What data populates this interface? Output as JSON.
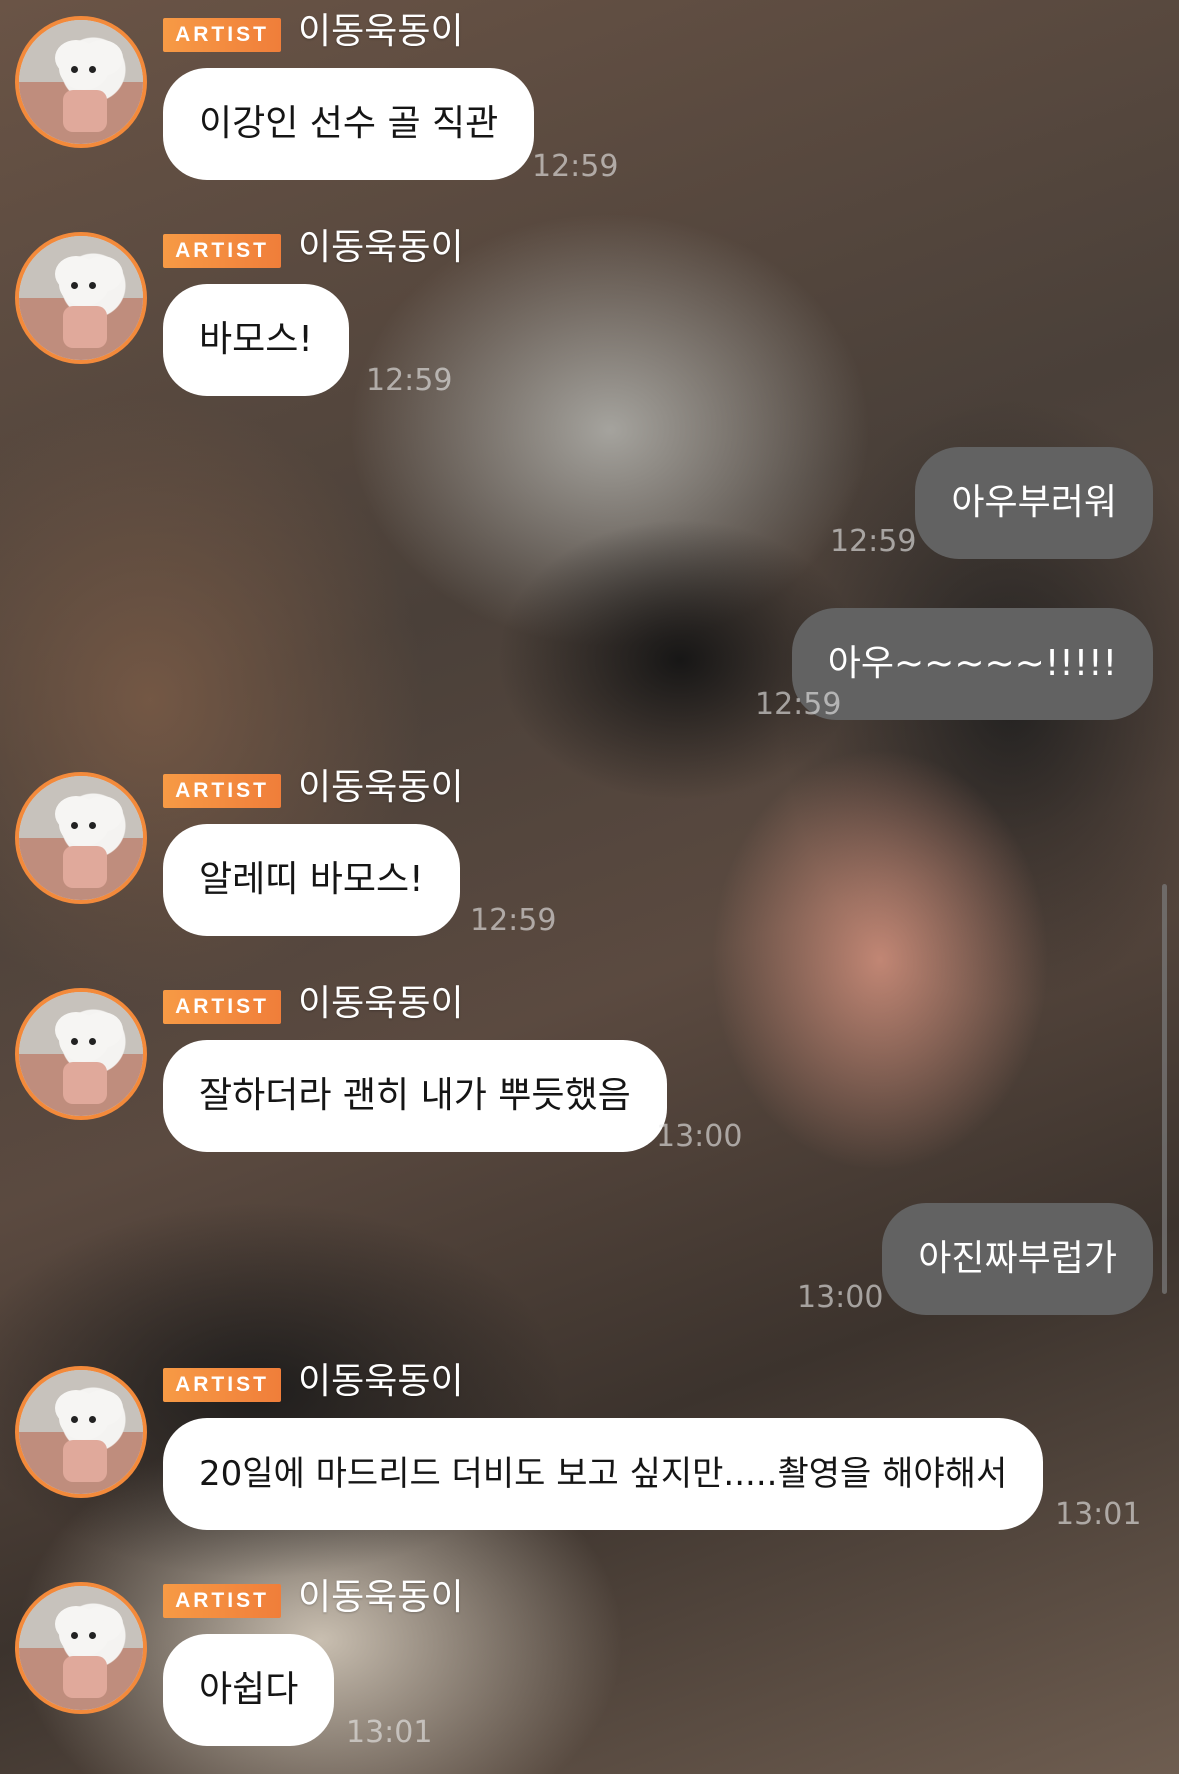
{
  "chat": {
    "artist_badge": "ARTIST",
    "messages": [
      {
        "sender": "이동욱동이",
        "text": "이강인 선수 골 직관",
        "time": "12:59"
      },
      {
        "sender": "이동욱동이",
        "text": "바모스!",
        "time": "12:59"
      },
      {
        "text": "아우부러워",
        "time": "12:59"
      },
      {
        "text": "아우~~~~~!!!!!",
        "time": "12:59"
      },
      {
        "sender": "이동욱동이",
        "text": "알레띠 바모스!",
        "time": "12:59"
      },
      {
        "sender": "이동욱동이",
        "text": "잘하더라 괜히 내가 뿌듯했음",
        "time": "13:00"
      },
      {
        "text": "아진짜부럽가",
        "time": "13:00"
      },
      {
        "sender": "이동욱동이",
        "text": "20일에 마드리드 더비도 보고 싶지만.....촬영을 해야해서",
        "time": "13:01"
      },
      {
        "sender": "이동욱동이",
        "text": "아쉽다",
        "time": "13:01"
      }
    ]
  },
  "colors": {
    "artist_badge": "#f07e3a",
    "avatar_ring": "#f38a3b",
    "incoming_bubble": "#ffffff",
    "outgoing_bubble": "#626262"
  }
}
